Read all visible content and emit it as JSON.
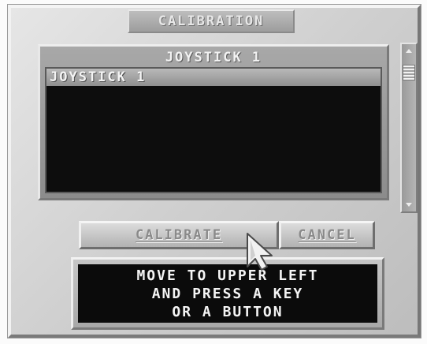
{
  "dialog": {
    "title": "CALIBRATION"
  },
  "device_list": {
    "header": "JOYSTICK 1",
    "items": [
      {
        "label": "JOYSTICK 1",
        "selected": true
      }
    ]
  },
  "buttons": {
    "calibrate_label": "CALIBRATE",
    "cancel_label": "CANCEL"
  },
  "message": {
    "lines": [
      "MOVE TO UPPER LEFT",
      "AND PRESS A KEY",
      "OR A BUTTON"
    ]
  },
  "icons": {
    "scroll_up": "chevron-up-icon",
    "scroll_down": "chevron-down-icon",
    "cursor": "arrow-cursor-icon"
  },
  "colors": {
    "panel": "#cfcfcf",
    "list_bg": "#0d0d0d",
    "selection": "#a9a9a9",
    "text_light": "#f4f4f4",
    "button_text": "#8a8a8a"
  }
}
